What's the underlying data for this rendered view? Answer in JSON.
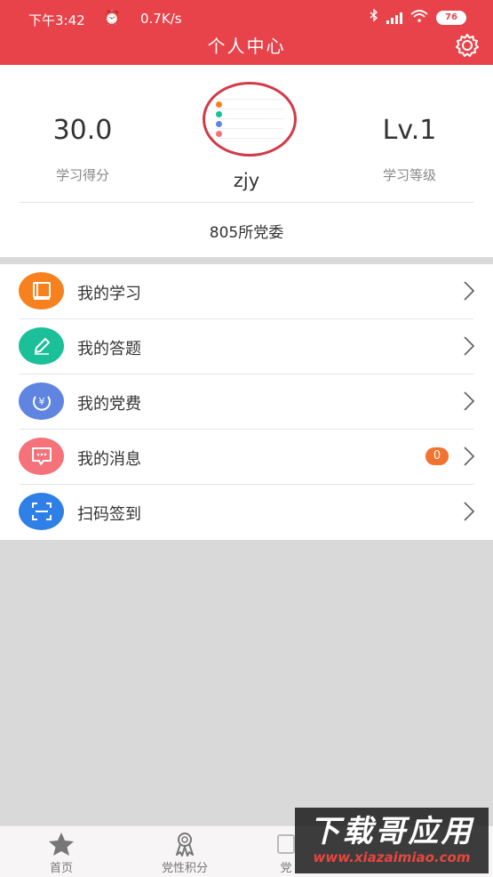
{
  "status_bar": {
    "time": "下午3:42",
    "network_speed": "0.7K/s",
    "battery": "76"
  },
  "header": {
    "title": "个人中心"
  },
  "profile": {
    "score_value": "30.0",
    "score_label": "学习得分",
    "level_value": "Lv.1",
    "level_label": "学习等级",
    "username": "zjy",
    "organization": "805所党委"
  },
  "menu": {
    "items": [
      {
        "label": "我的学习",
        "icon": "book-icon",
        "color": "#f7801f"
      },
      {
        "label": "我的答题",
        "icon": "pencil-icon",
        "color": "#1bbf98"
      },
      {
        "label": "我的党费",
        "icon": "yuan-coin-icon",
        "color": "#5f85e0"
      },
      {
        "label": "我的消息",
        "icon": "message-icon",
        "color": "#f5727a",
        "badge": "0"
      },
      {
        "label": "扫码签到",
        "icon": "scan-icon",
        "color": "#2e7fe6"
      }
    ]
  },
  "tabbar": {
    "tabs": [
      {
        "label": "首页",
        "icon": "star-icon"
      },
      {
        "label": "党性积分",
        "icon": "medal-icon"
      },
      {
        "label": "党",
        "icon": "party-icon"
      }
    ]
  },
  "watermark": {
    "line1": "下载哥应用",
    "line2": "www.xiazaimiao.com"
  },
  "colors": {
    "header_bg": "#e8434a",
    "badge": "#f27230"
  }
}
